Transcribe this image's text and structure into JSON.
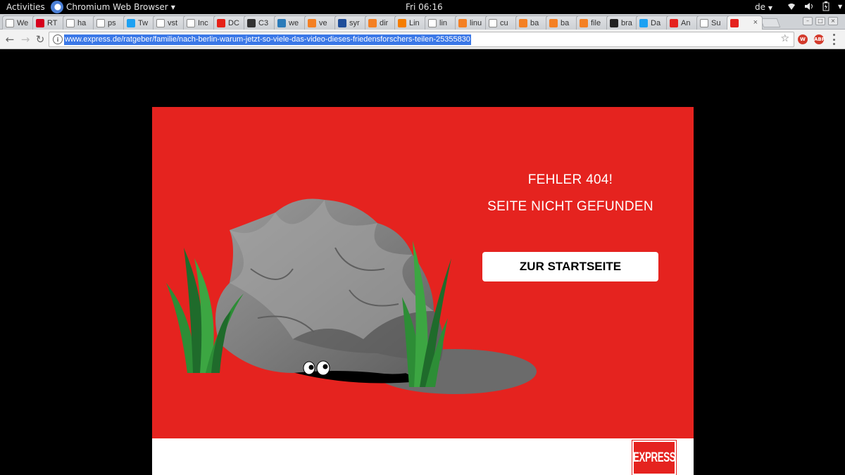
{
  "system_bar": {
    "activities": "Activities",
    "app_name": "Chromium Web Browser",
    "clock": "Fri 06:16",
    "input_language": "de"
  },
  "tabs": [
    {
      "title": "We",
      "favicon": "page-icon"
    },
    {
      "title": "RT",
      "favicon": "rt-icon"
    },
    {
      "title": "ha",
      "favicon": "page-icon"
    },
    {
      "title": "ps",
      "favicon": "page-icon"
    },
    {
      "title": "Tw",
      "favicon": "twitter-icon"
    },
    {
      "title": "vst",
      "favicon": "google-icon"
    },
    {
      "title": "Inc",
      "favicon": "page-icon"
    },
    {
      "title": "DC",
      "favicon": "youtube-icon"
    },
    {
      "title": "C3",
      "favicon": "c3-icon"
    },
    {
      "title": "we",
      "favicon": "bracket-icon"
    },
    {
      "title": "ve",
      "favicon": "stackoverflow-icon"
    },
    {
      "title": "syr",
      "favicon": "uk-icon"
    },
    {
      "title": "dir",
      "favicon": "stackoverflow-icon"
    },
    {
      "title": "Lin",
      "favicon": "blogger-icon"
    },
    {
      "title": "lin",
      "favicon": "google-icon"
    },
    {
      "title": "linu",
      "favicon": "stackoverflow-icon"
    },
    {
      "title": "cu",
      "favicon": "wikipedia-icon"
    },
    {
      "title": "ba",
      "favicon": "stackoverflow-icon"
    },
    {
      "title": "ba",
      "favicon": "stackoverflow-icon"
    },
    {
      "title": "file",
      "favicon": "stackoverflow-icon"
    },
    {
      "title": "bra",
      "favicon": "github-icon"
    },
    {
      "title": "Da",
      "favicon": "twitter-icon"
    },
    {
      "title": "An",
      "favicon": "express-icon"
    },
    {
      "title": "Su",
      "favicon": "wikipedia-icon"
    },
    {
      "title": "",
      "favicon": "express-icon",
      "active": true
    }
  ],
  "address_bar": {
    "url": "www.express.de/ratgeber/familie/nach-berlin-warum-jetzt-so-viele-das-video-dieses-friedensforschers-teilen-25355830"
  },
  "page": {
    "error_title": "FEHLER 404!",
    "error_subtitle": "SEITE NICHT GEFUNDEN",
    "home_button": "ZUR STARTSEITE",
    "logo_text": "EXPRESS",
    "colors": {
      "brand_red": "#e5231f",
      "button_bg": "#ffffff"
    }
  }
}
